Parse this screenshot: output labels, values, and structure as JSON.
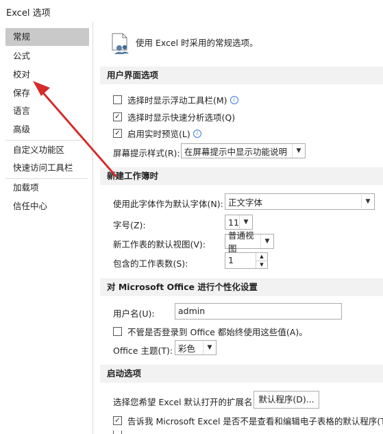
{
  "window": {
    "title": "Excel 选项"
  },
  "sidebar": {
    "items": [
      {
        "label": "常规",
        "selected": true
      },
      {
        "label": "公式"
      },
      {
        "label": "校对"
      },
      {
        "label": "保存"
      },
      {
        "label": "语言"
      },
      {
        "label": "高级"
      },
      {
        "label": "自定义功能区"
      },
      {
        "label": "快速访问工具栏"
      },
      {
        "label": "加载项"
      },
      {
        "label": "信任中心"
      }
    ]
  },
  "header": {
    "text": "使用 Excel 时采用的常规选项。"
  },
  "ui_section": {
    "title": "用户界面选项",
    "opt_mini_toolbar": {
      "label": "选择时显示浮动工具栏(M)",
      "checked": false
    },
    "opt_quick_analysis": {
      "label": "选择时显示快速分析选项(Q)",
      "checked": true
    },
    "opt_live_preview": {
      "label": "启用实时预览(L)",
      "checked": true
    },
    "screentip_label": "屏幕提示样式(R):",
    "screentip_value": "在屏幕提示中显示功能说明"
  },
  "workbook_section": {
    "title": "新建工作簿时",
    "font_label": "使用此字体作为默认字体(N):",
    "font_value": "正文字体",
    "size_label": "字号(Z):",
    "size_value": "11",
    "view_label": "新工作表的默认视图(V):",
    "view_value": "普通视图",
    "sheets_label": "包含的工作表数(S):",
    "sheets_value": "1"
  },
  "personalize_section": {
    "title": "对 Microsoft Office 进行个性化设置",
    "username_label": "用户名(U):",
    "username_value": "admin",
    "always_use_label": "不管是否登录到 Office 都始终使用这些值(A)。",
    "always_use_checked": false,
    "theme_label": "Office 主题(T):",
    "theme_value": "彩色"
  },
  "startup_section": {
    "title": "启动选项",
    "ext_label": "选择您希望 Excel 默认打开的扩展名:",
    "default_programs_button": "默认程序(D)...",
    "tell_me_label": "告诉我 Microsoft Excel 是否不是查看和编辑电子表格的默认程序(T)。",
    "tell_me_checked": true
  },
  "icons": {
    "info": "i",
    "check": "✓",
    "dropdown": "▼",
    "spin_up": "▲",
    "spin_down": "▼"
  },
  "colors": {
    "annotation_arrow": "#d42b2b",
    "selected_nav": "#c9c9c9",
    "section_bg": "#f2f2f2"
  }
}
